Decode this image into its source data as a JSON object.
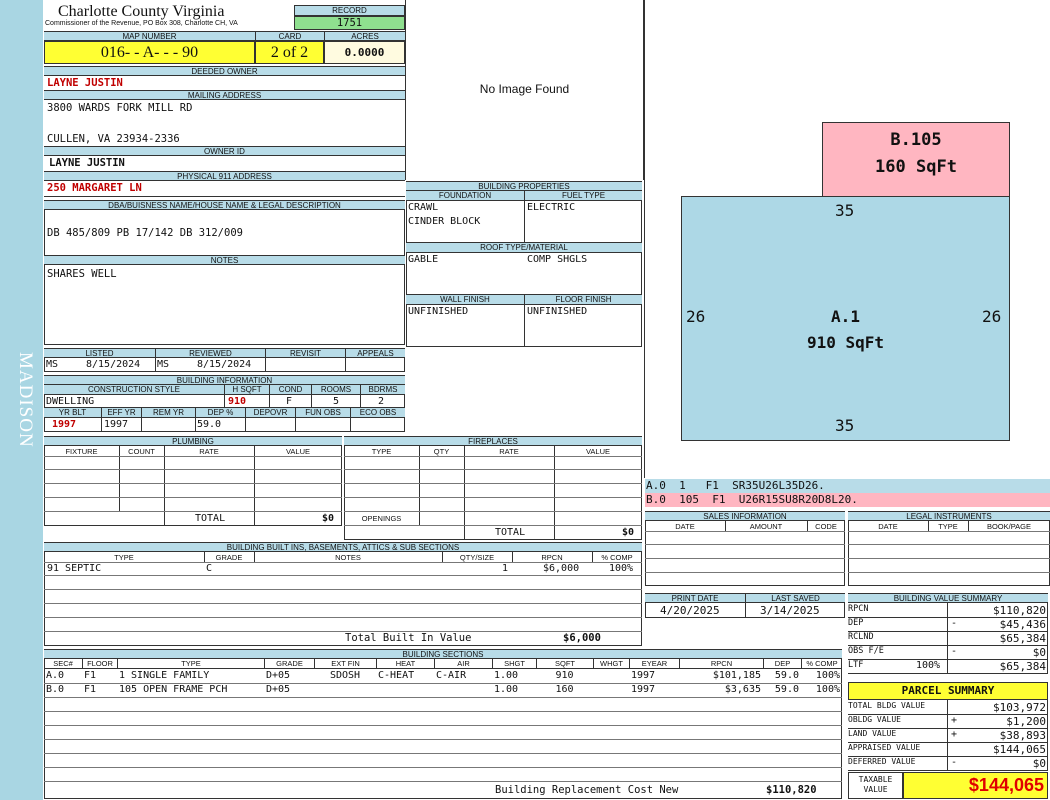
{
  "side_label": "MADISON",
  "header": {
    "county": "Charlotte County Virginia",
    "commissioner": "Commissioner of the Revenue, PO Box 308, Charlotte CH, VA",
    "record_label": "RECORD",
    "record": "1751",
    "map_label": "MAP NUMBER",
    "map_number": "016- - A- - - 90",
    "card_label": "CARD",
    "card": "2 of 2",
    "acres_label": "ACRES",
    "acres": "0.0000"
  },
  "owner": {
    "deeded_label": "DEEDED OWNER",
    "deeded_owner": "LAYNE JUSTIN",
    "mailing_label": "MAILING ADDRESS",
    "address1": "3800 WARDS FORK MILL RD",
    "address2": "CULLEN, VA 23934-2336",
    "owner_id_label": "OWNER ID",
    "owner_id": "LAYNE JUSTIN",
    "physical_label": "PHYSICAL 911 ADDRESS",
    "physical": "250 MARGARET LN",
    "dba_label": "DBA/BUISNESS NAME/HOUSE NAME & LEGAL DESCRIPTION",
    "dba": "DB 485/809 PB 17/142 DB 312/009",
    "notes_label": "NOTES",
    "notes": "SHARES WELL"
  },
  "listing": {
    "listed_label": "LISTED",
    "reviewed_label": "REVIEWED",
    "revisit_label": "REVISIT",
    "appeals_label": "APPEALS",
    "listed_by": "MS",
    "listed_date": "8/15/2024",
    "reviewed_by": "MS",
    "reviewed_date": "8/15/2024"
  },
  "building_info": {
    "title": "BUILDING INFORMATION",
    "style_label": "CONSTRUCTION STYLE",
    "hsqft_label": "H SQFT",
    "cond_label": "COND",
    "rooms_label": "ROOMS",
    "bdrms_label": "BDRMS",
    "style": "DWELLING",
    "hsqft": "910",
    "cond": "F",
    "rooms": "5",
    "bdrms": "2",
    "yrblt_label": "YR BLT",
    "effyr_label": "EFF YR",
    "remyr_label": "REM YR",
    "dep_label": "DEP %",
    "depovr_label": "DEPOVR",
    "funobs_label": "FUN OBS",
    "ecoobs_label": "ECO OBS",
    "yr_blt": "1997",
    "eff_yr": "1997",
    "dep": "59.0"
  },
  "image_placeholder": "No Image Found",
  "building_props": {
    "title": "BUILDING PROPERTIES",
    "foundation_label": "FOUNDATION",
    "fuel_label": "FUEL TYPE",
    "foundation1": "CRAWL",
    "foundation2": "CINDER BLOCK",
    "fuel": "ELECTRIC",
    "roof_label": "ROOF TYPE/MATERIAL",
    "roof_type": "GABLE",
    "roof_material": "COMP SHGLS",
    "wall_label": "WALL FINISH",
    "floor_label": "FLOOR FINISH",
    "wall": "UNFINISHED",
    "floor": "UNFINISHED"
  },
  "sketch": {
    "b_label": "B.105",
    "b_area": "160 SqFt",
    "a_label": "A.1",
    "a_area": "910 SqFt",
    "dim_top": "35",
    "dim_bottom": "35",
    "dim_left": "26",
    "dim_right": "26",
    "vector_a": "A.0  1   F1  SR35U26L35D26.",
    "vector_b": "B.0  105  F1  U26R15SU8R20D8L20."
  },
  "plumbing": {
    "title": "PLUMBING",
    "fixture": "FIXTURE",
    "count": "COUNT",
    "rate": "RATE",
    "value": "VALUE",
    "total_label": "TOTAL",
    "total": "$0"
  },
  "fireplaces": {
    "title": "FIREPLACES",
    "type": "TYPE",
    "qty": "QTY",
    "rate": "RATE",
    "value": "VALUE",
    "openings": "OPENINGS",
    "total_label": "TOTAL",
    "total": "$0"
  },
  "sales": {
    "title": "SALES INFORMATION",
    "date": "DATE",
    "amount": "AMOUNT",
    "code": "CODE"
  },
  "legal": {
    "title": "LEGAL INSTRUMENTS",
    "date": "DATE",
    "type": "TYPE",
    "bookpage": "BOOK/PAGE"
  },
  "builtins": {
    "title": "BUILDING BUILT INS, BASEMENTS, ATTICS & SUB SECTIONS",
    "type": "TYPE",
    "grade": "GRADE",
    "notes": "NOTES",
    "qty": "QTY/SIZE",
    "rpcn": "RPCN",
    "comp": "% COMP",
    "row_type": "91 SEPTIC",
    "row_grade": "C",
    "row_qty": "1",
    "row_rpcn": "$6,000",
    "row_comp": "100%",
    "total_label": "Total Built In Value",
    "total": "$6,000"
  },
  "print": {
    "print_label": "PRINT DATE",
    "saved_label": "LAST SAVED",
    "print_date": "4/20/2025",
    "last_saved": "3/14/2025"
  },
  "value_summary": {
    "title": "BUILDING VALUE SUMMARY",
    "rows": [
      {
        "label": "RPCN",
        "sign": "",
        "value": "$110,820"
      },
      {
        "label": "DEP",
        "sign": "-",
        "value": "$45,436"
      },
      {
        "label": "RCLND",
        "sign": "",
        "value": "$65,384"
      },
      {
        "label": "OBS F/E",
        "sign": "-",
        "value": "$0"
      },
      {
        "label": "LTF",
        "sign": "",
        "value": "$65,384"
      }
    ],
    "ltf_pct": "100%"
  },
  "parcel": {
    "title": "PARCEL SUMMARY",
    "rows": [
      {
        "label": "TOTAL BLDG VALUE",
        "sign": "",
        "value": "$103,972"
      },
      {
        "label": "OBLDG VALUE",
        "sign": "+",
        "value": "$1,200"
      },
      {
        "label": "LAND VALUE",
        "sign": "+",
        "value": "$38,893"
      },
      {
        "label": "APPRAISED VALUE",
        "sign": "",
        "value": "$144,065"
      },
      {
        "label": "DEFERRED VALUE",
        "sign": "-",
        "value": "$0"
      }
    ],
    "taxable_label1": "TAXABLE",
    "taxable_label2": "VALUE",
    "taxable": "$144,065"
  },
  "sections": {
    "title": "BUILDING SECTIONS",
    "headers": [
      "SEC#",
      "FLOOR",
      "TYPE",
      "GRADE",
      "EXT FIN",
      "HEAT",
      "AIR",
      "SHGT",
      "SQFT",
      "WHGT",
      "EYEAR",
      "RPCN",
      "DEP",
      "% COMP"
    ],
    "rows": [
      [
        "A.0",
        "F1",
        "1 SINGLE FAMILY",
        "D+05",
        "SDOSH",
        "C-HEAT",
        "C-AIR",
        "1.00",
        "910",
        "",
        "1997",
        "$101,185",
        "59.0",
        "100%"
      ],
      [
        "B.0",
        "F1",
        "105 OPEN FRAME PCH",
        "D+05",
        "",
        "",
        "",
        "1.00",
        "160",
        "",
        "1997",
        "$3,635",
        "59.0",
        "100%"
      ]
    ],
    "total_label": "Building Replacement Cost New",
    "total": "$110,820"
  }
}
